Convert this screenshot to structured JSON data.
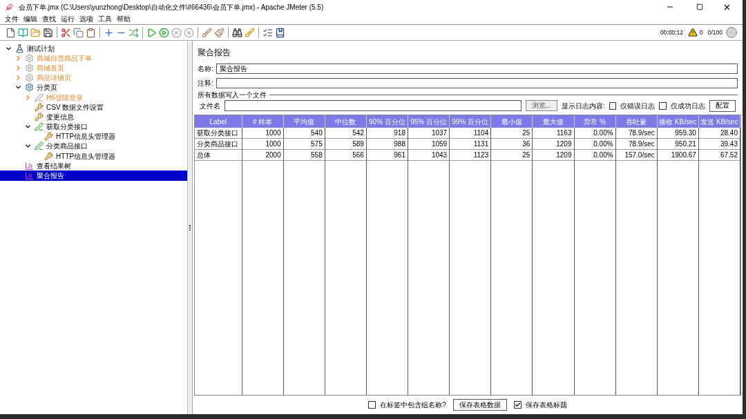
{
  "window": {
    "title": "会员下单.jmx (C:\\Users\\yunzhong\\Desktop\\自动化文件\\#66436\\会员下单.jmx) - Apache JMeter (5.5)"
  },
  "menu": [
    "文件",
    "编辑",
    "查找",
    "运行",
    "选项",
    "工具",
    "帮助"
  ],
  "status": {
    "elapsed": "00:00:12",
    "warnings": "0",
    "threads": "0/100"
  },
  "tree": [
    {
      "label": "测试计划",
      "kind": "plan",
      "expanded": true,
      "disabled": false,
      "selected": false,
      "children": [
        {
          "label": "商城自营商品下单",
          "kind": "threadgroup",
          "expanded": false,
          "disabled": true,
          "selected": false
        },
        {
          "label": "商城首页",
          "kind": "threadgroup",
          "expanded": false,
          "disabled": true,
          "selected": false
        },
        {
          "label": "商品详细页",
          "kind": "threadgroup",
          "expanded": false,
          "disabled": true,
          "selected": false
        },
        {
          "label": "分类页",
          "kind": "threadgroup",
          "expanded": true,
          "disabled": false,
          "selected": false,
          "children": [
            {
              "label": "H5登陆登录",
              "kind": "sampler",
              "expanded": false,
              "disabled": true,
              "selected": false
            },
            {
              "label": "CSV 数据文件设置",
              "kind": "config",
              "disabled": false,
              "selected": false
            },
            {
              "label": "变更信息",
              "kind": "config",
              "disabled": false,
              "selected": false
            },
            {
              "label": "获取分类接口",
              "kind": "sampler",
              "expanded": true,
              "disabled": false,
              "selected": false,
              "children": [
                {
                  "label": "HTTP信息头管理器",
                  "kind": "config",
                  "disabled": false,
                  "selected": false
                }
              ]
            },
            {
              "label": "分类商品接口",
              "kind": "sampler",
              "expanded": true,
              "disabled": false,
              "selected": false,
              "children": [
                {
                  "label": "HTTP信息头管理器",
                  "kind": "config",
                  "disabled": false,
                  "selected": false
                }
              ]
            }
          ]
        },
        {
          "label": "查看结果树",
          "kind": "listener",
          "disabled": false,
          "selected": false
        },
        {
          "label": "聚合报告",
          "kind": "listener",
          "disabled": false,
          "selected": true
        }
      ]
    }
  ],
  "panel": {
    "title": "聚合报告",
    "name_label": "名称:",
    "name_value": "聚合报告",
    "comment_label": "注释:",
    "file_section": "所有数据写入一个文件",
    "file_label": "文件名",
    "browse": "浏览...",
    "log_label": "显示日志内容:",
    "errors_only": {
      "label": "仅错误日志",
      "checked": false
    },
    "success_only": {
      "label": "仅成功日志",
      "checked": false
    },
    "configure": "配置"
  },
  "table": {
    "columns": [
      "Label",
      "# 样本",
      "平均值",
      "中位数",
      "90% 百分位",
      "95% 百分位",
      "99% 百分位",
      "最小值",
      "最大值",
      "异常 %",
      "吞吐量",
      "接收 KB/sec",
      "发送 KB/sec"
    ],
    "rows": [
      [
        "获取分类接口",
        "1000",
        "540",
        "542",
        "918",
        "1037",
        "1104",
        "25",
        "1163",
        "0.00%",
        "78.9/sec",
        "959.30",
        "28.40"
      ],
      [
        "分类商品接口",
        "1000",
        "575",
        "589",
        "988",
        "1059",
        "1131",
        "36",
        "1209",
        "0.00%",
        "78.9/sec",
        "950.21",
        "39.43"
      ],
      [
        "总体",
        "2000",
        "558",
        "566",
        "961",
        "1043",
        "1123",
        "25",
        "1209",
        "0.00%",
        "157.0/sec",
        "1900.67",
        "67.52"
      ]
    ]
  },
  "footer": {
    "include_group": {
      "label": "在标签中包含组名称?",
      "checked": false
    },
    "save_data": "保存表格数据",
    "save_header": {
      "label": "保存表格标题",
      "checked": true
    }
  }
}
